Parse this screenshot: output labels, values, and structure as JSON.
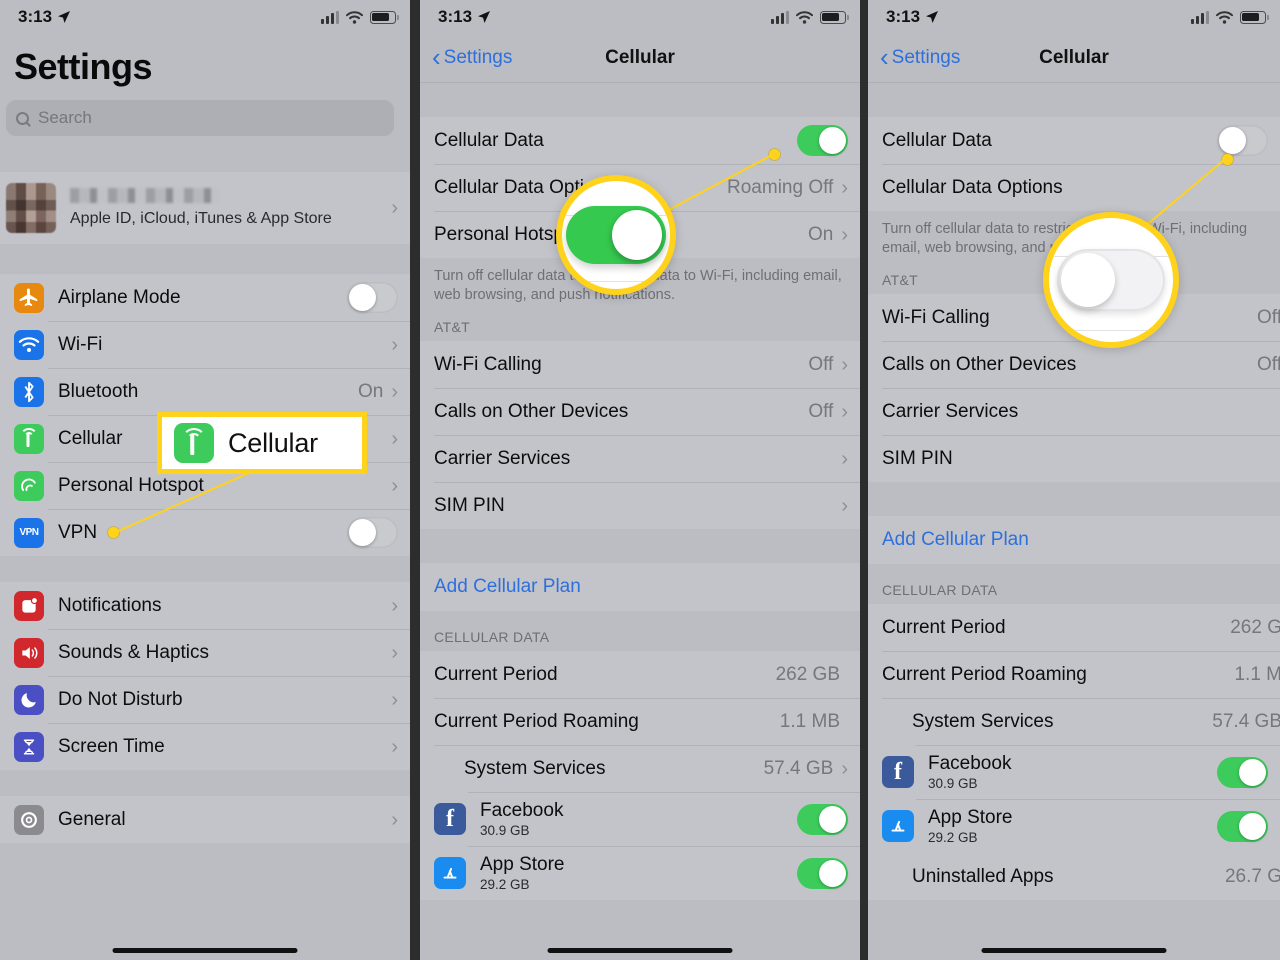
{
  "status_bar": {
    "time": "3:13",
    "location_icon": "location-arrow-icon",
    "signal_icon": "cellular-bars-icon",
    "wifi_icon": "wifi-icon",
    "battery_icon": "battery-icon"
  },
  "panel1": {
    "title": "Settings",
    "search_placeholder": "Search",
    "apple_id": {
      "subtitle": "Apple ID, iCloud, iTunes & App Store"
    },
    "groups": [
      {
        "items": [
          {
            "label": "Airplane Mode",
            "icon": "airplane-icon",
            "color": "#e8890f",
            "control": "toggle-off"
          },
          {
            "label": "Wi-Fi",
            "icon": "wifi-icon",
            "color": "#1a73e8",
            "control": "chevron",
            "value": ""
          },
          {
            "label": "Bluetooth",
            "icon": "bluetooth-icon",
            "color": "#1a73e8",
            "control": "chevron",
            "value": "On"
          },
          {
            "label": "Cellular",
            "icon": "cellular-icon",
            "color": "#3dcb5c",
            "control": "chevron",
            "value": ""
          },
          {
            "label": "Personal Hotspot",
            "icon": "hotspot-icon",
            "color": "#3dcb5c",
            "control": "chevron",
            "value": ""
          },
          {
            "label": "VPN",
            "icon": "vpn-icon",
            "color": "#1a73e8",
            "control": "toggle-off"
          }
        ]
      },
      {
        "items": [
          {
            "label": "Notifications",
            "icon": "notifications-icon",
            "color": "#d1282e",
            "control": "chevron",
            "value": ""
          },
          {
            "label": "Sounds & Haptics",
            "icon": "sounds-icon",
            "color": "#d1282e",
            "control": "chevron",
            "value": ""
          },
          {
            "label": "Do Not Disturb",
            "icon": "moon-icon",
            "color": "#4a4fc4",
            "control": "chevron",
            "value": ""
          },
          {
            "label": "Screen Time",
            "icon": "hourglass-icon",
            "color": "#4a4fc4",
            "control": "chevron",
            "value": ""
          }
        ]
      },
      {
        "items": [
          {
            "label": "General",
            "icon": "gear-icon",
            "color": "#8a8a8f",
            "control": "chevron",
            "value": ""
          }
        ]
      }
    ]
  },
  "panel2": {
    "back_label": "Settings",
    "nav_title": "Cellular",
    "rows_top": [
      {
        "label": "Cellular Data",
        "control": "toggle-on"
      },
      {
        "label": "Cellular Data Options",
        "value": "Roaming Off",
        "control": "chevron"
      },
      {
        "label": "Personal Hotspot",
        "value": "On",
        "control": "chevron"
      }
    ],
    "footnote": "Turn off cellular data to restrict all data to Wi-Fi, including email, web browsing, and push notifications.",
    "carrier_header": "AT&T",
    "carrier_rows": [
      {
        "label": "Wi-Fi Calling",
        "value": "Off",
        "control": "chevron"
      },
      {
        "label": "Calls on Other Devices",
        "value": "Off",
        "control": "chevron"
      },
      {
        "label": "Carrier Services",
        "value": "",
        "control": "chevron"
      },
      {
        "label": "SIM PIN",
        "value": "",
        "control": "chevron"
      }
    ],
    "add_plan": "Add Cellular Plan",
    "data_header": "CELLULAR DATA",
    "data_rows": [
      {
        "label": "Current Period",
        "value": "262 GB",
        "control": "none"
      },
      {
        "label": "Current Period Roaming",
        "value": "1.1 MB",
        "control": "none"
      },
      {
        "label": "System Services",
        "value": "57.4 GB",
        "control": "chevron",
        "indent": true
      }
    ],
    "apps": [
      {
        "name": "Facebook",
        "size": "30.9 GB",
        "icon": "facebook-icon",
        "color": "#3b5a9b",
        "control": "toggle-on"
      },
      {
        "name": "App Store",
        "size": "29.2 GB",
        "icon": "app-store-icon",
        "color": "#1a8cf0",
        "control": "toggle-on"
      }
    ]
  },
  "panel3": {
    "back_label": "Settings",
    "nav_title": "Cellular",
    "rows_top": [
      {
        "label": "Cellular Data",
        "control": "toggle-off"
      },
      {
        "label": "Cellular Data Options",
        "value": "",
        "control": "none"
      }
    ],
    "footnote": "Turn off cellular data to restrict all data to Wi-Fi, including email, web browsing, and push notifications.",
    "carrier_header": "AT&T",
    "carrier_rows": [
      {
        "label": "Wi-Fi Calling",
        "value": "Off",
        "control": "none"
      },
      {
        "label": "Calls on Other Devices",
        "value": "Off",
        "control": "none"
      },
      {
        "label": "Carrier Services",
        "value": "",
        "control": "none"
      },
      {
        "label": "SIM PIN",
        "value": "",
        "control": "none"
      }
    ],
    "add_plan": "Add Cellular Plan",
    "data_header": "CELLULAR DATA",
    "data_rows": [
      {
        "label": "Current Period",
        "value": "262 G",
        "control": "none"
      },
      {
        "label": "Current Period Roaming",
        "value": "1.1 M",
        "control": "none"
      },
      {
        "label": "System Services",
        "value": "57.4 GB",
        "control": "none",
        "indent": true
      }
    ],
    "apps": [
      {
        "name": "Facebook",
        "size": "30.9 GB",
        "icon": "facebook-icon",
        "color": "#3b5a9b",
        "control": "toggle-on"
      },
      {
        "name": "App Store",
        "size": "29.2 GB",
        "icon": "app-store-icon",
        "color": "#1a8cf0",
        "control": "toggle-on"
      }
    ],
    "last_row": {
      "label": "Uninstalled Apps",
      "value": "26.7 G"
    }
  },
  "annotations": {
    "callout_label": "Cellular",
    "callout_icon": "cellular-icon",
    "accent_color": "#ffd21c",
    "magnifier2_state": "toggle-on",
    "magnifier3_state": "toggle-off"
  }
}
